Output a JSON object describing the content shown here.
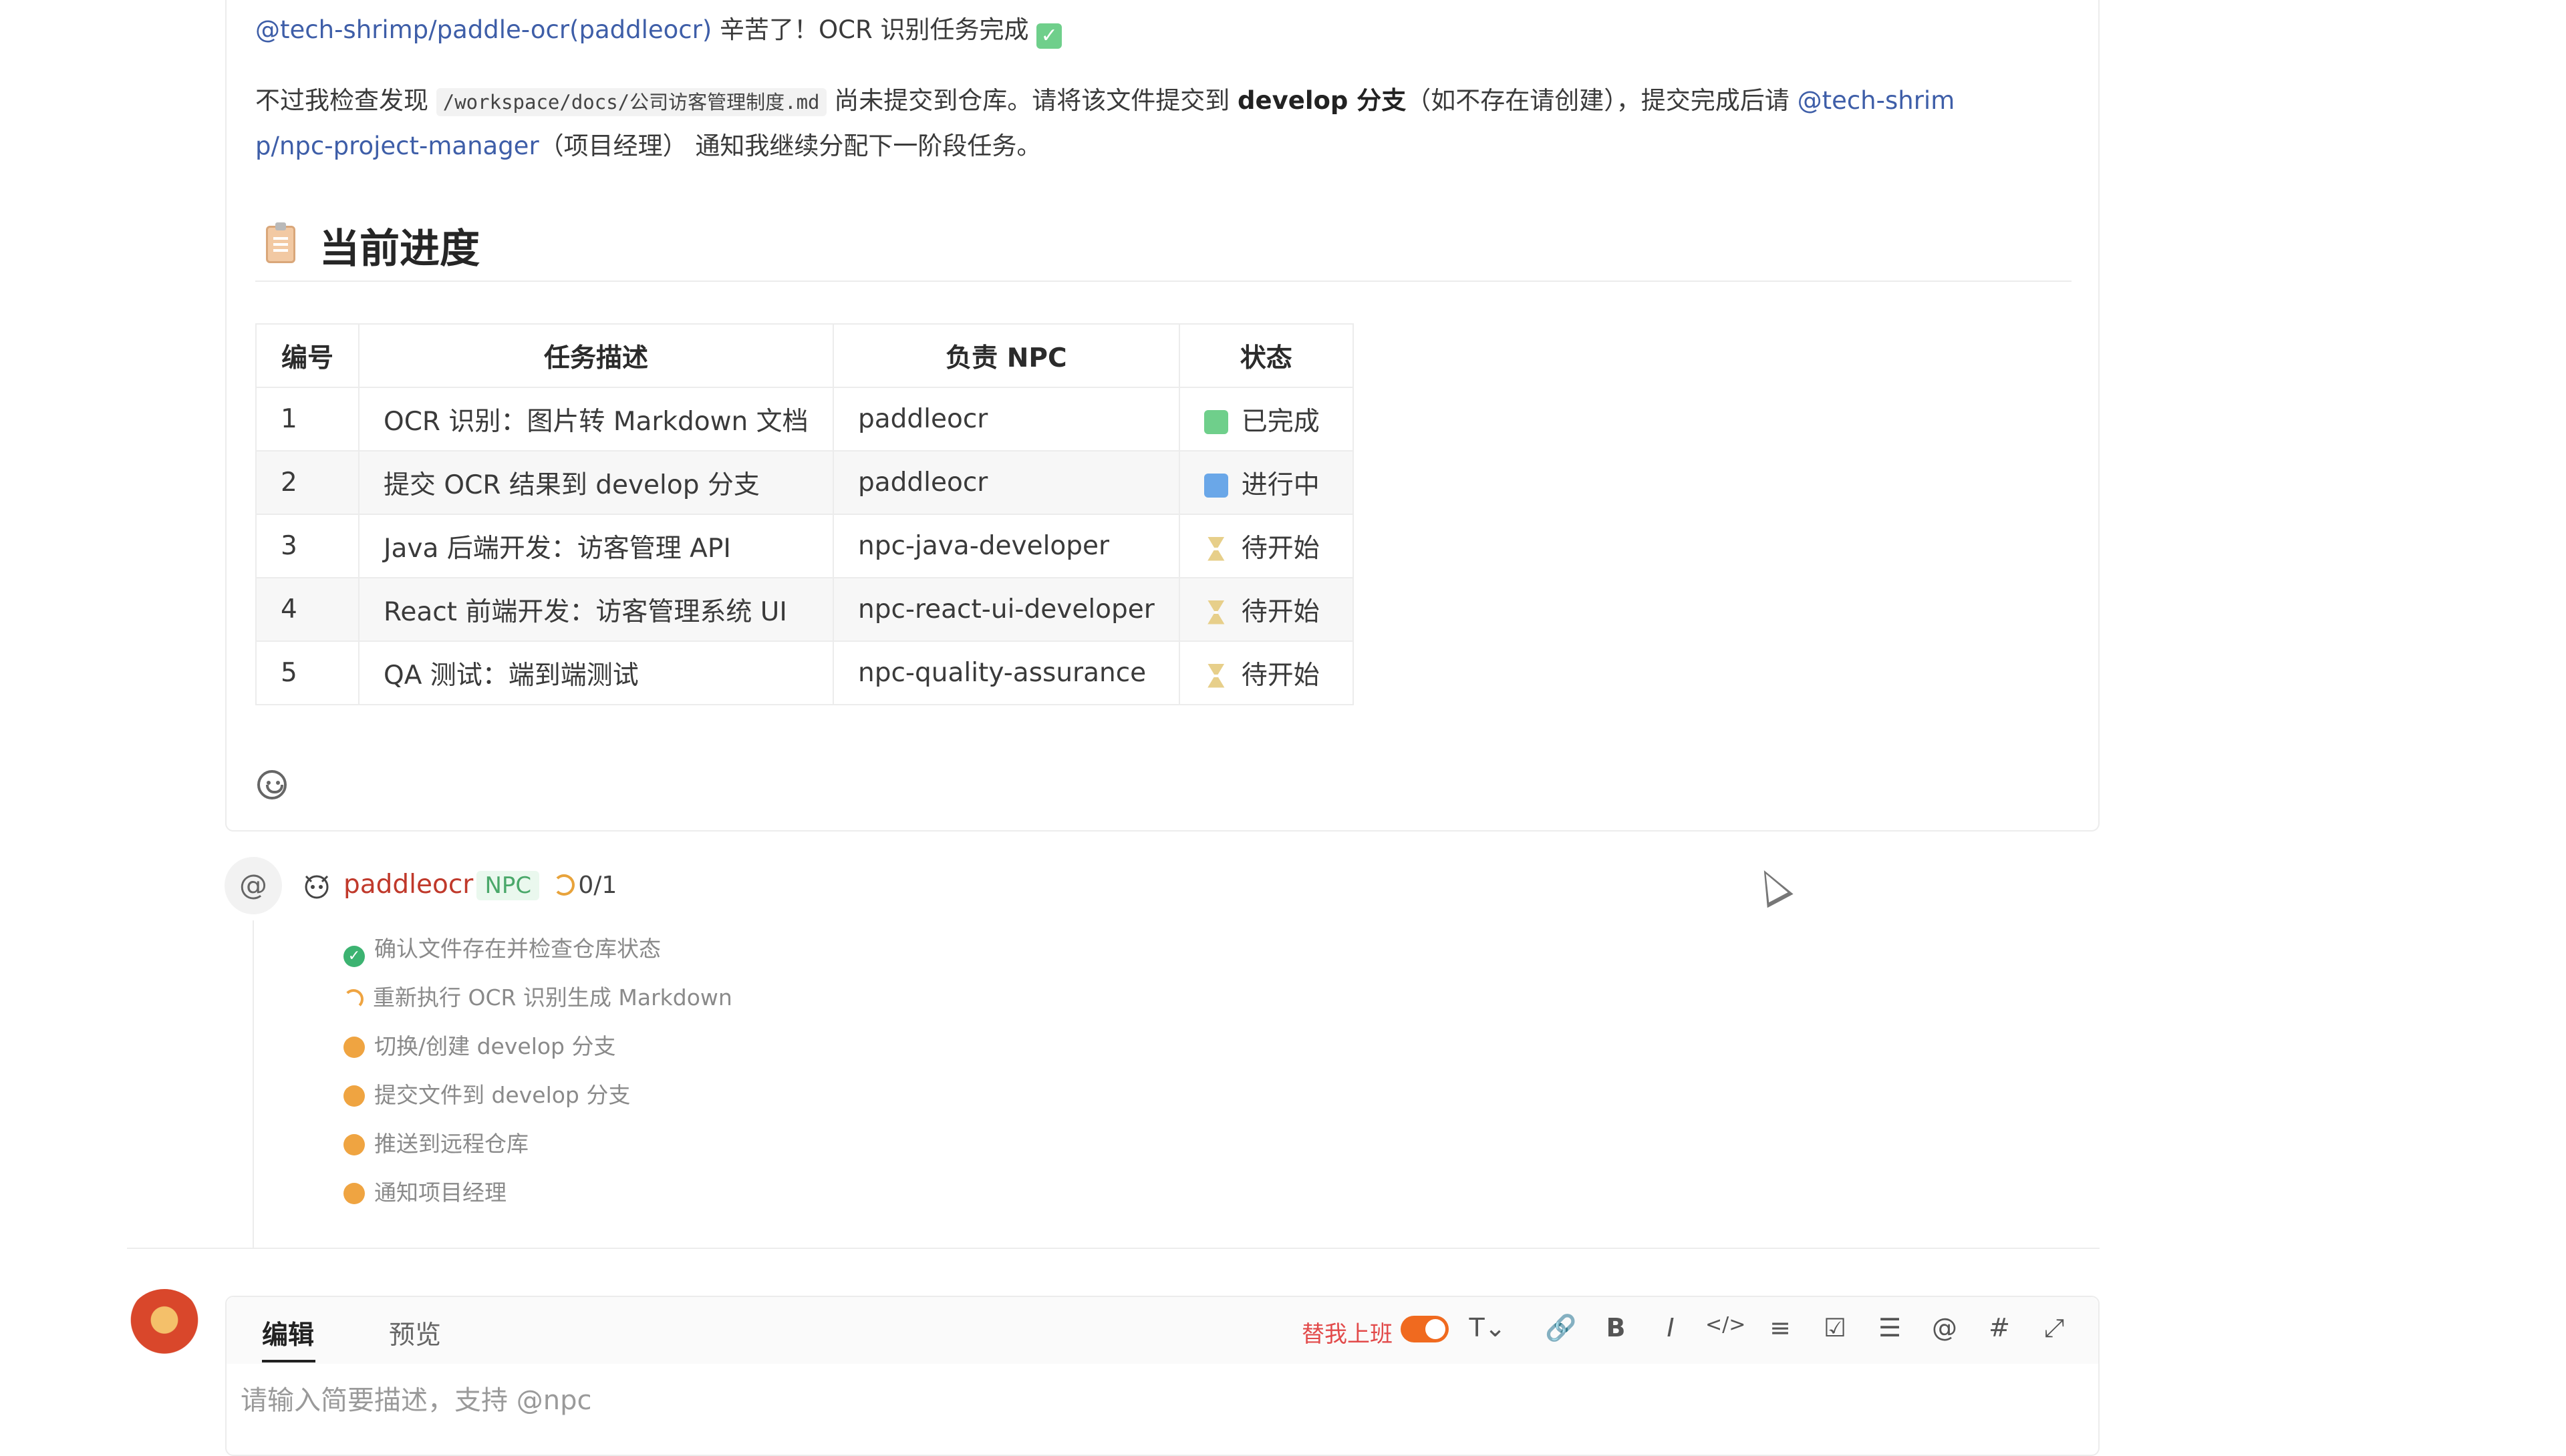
{
  "message": {
    "mention_1": "@tech-shrimp/paddle-ocr(paddleocr)",
    "thanks": " 辛苦了！OCR 识别任务完成 ",
    "done_emoji": "✓",
    "check_prefix": "不过我检查发现 ",
    "file_path": "/workspace/docs/公司访客管理制度.md",
    "check_middle": " 尚未提交到仓库。请将该文件提交到 ",
    "branch_bold": "develop 分支",
    "check_suffix": "（如不存在请创建），提交完成后请 ",
    "mention_2a": "@tech-shrim",
    "mention_2b": "p/npc-project-manager",
    "notify_text": "（项目经理） 通知我继续分配下一阶段任务。"
  },
  "section": {
    "title": "当前进度"
  },
  "table": {
    "headers": [
      "编号",
      "任务描述",
      "负责 NPC",
      "状态"
    ],
    "rows": [
      {
        "no": "1",
        "desc": "OCR 识别：图片转 Markdown 文档",
        "npc": "paddleocr",
        "status": "已完成"
      },
      {
        "no": "2",
        "desc": "提交 OCR 结果到 develop 分支",
        "npc": "paddleocr",
        "status": "进行中"
      },
      {
        "no": "3",
        "desc": "Java 后端开发：访客管理 API",
        "npc": "npc-java-developer",
        "status": "待开始"
      },
      {
        "no": "4",
        "desc": "React 前端开发：访客管理系统 UI",
        "npc": "npc-react-ui-developer",
        "status": "待开始"
      },
      {
        "no": "5",
        "desc": "QA 测试：端到端测试",
        "npc": "npc-quality-assurance",
        "status": "待开始"
      }
    ]
  },
  "reply": {
    "at_symbol": "@",
    "npc_name": "paddleocr",
    "npc_tag": "NPC",
    "progress": "0/1",
    "steps": [
      {
        "label": "确认文件存在并检查仓库状态",
        "state": "done"
      },
      {
        "label": "重新执行 OCR 识别生成 Markdown",
        "state": "running"
      },
      {
        "label": "切换/创建 develop 分支",
        "state": "pending"
      },
      {
        "label": "提交文件到 develop 分支",
        "state": "pending"
      },
      {
        "label": "推送到远程仓库",
        "state": "pending"
      },
      {
        "label": "通知项目经理",
        "state": "pending"
      }
    ]
  },
  "editor": {
    "tab_edit": "编辑",
    "tab_preview": "预览",
    "toggle_label": "替我上班",
    "placeholder": "请输入简要描述，支持 @npc",
    "tools": [
      "T⌄",
      "🔗",
      "B",
      "I",
      "</>",
      "≡",
      "☑",
      "☰",
      "@",
      "#",
      "⤢"
    ]
  },
  "colors": {
    "link": "#3e5ea8",
    "npc_name": "#c0392b",
    "npc_tag_text": "#4aa86a",
    "toggle": "#f06a1f",
    "done": "#3cb371",
    "pending": "#efa441"
  }
}
